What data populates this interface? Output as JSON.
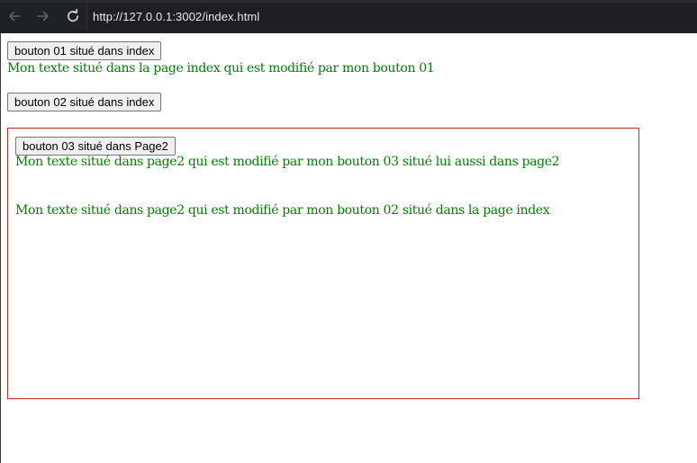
{
  "browser": {
    "back_icon": "arrow-left-icon",
    "forward_icon": "arrow-right-icon",
    "reload_icon": "reload-icon",
    "url": "http://127.0.0.1:3002/index.html",
    "colors": {
      "toolbar_bg": "#202124",
      "icon_color": "#9aa0a6",
      "text_color": "#e8eaed"
    }
  },
  "index": {
    "button_01_label": "bouton 01 situé dans index",
    "text_01": "Mon texte situé dans la page index qui est modifié par mon bouton 01",
    "button_02_label": "bouton 02 situé dans index"
  },
  "page2": {
    "button_03_label": "bouton 03 situé dans Page2",
    "text_03": "Mon texte situé dans page2 qui est modifié par mon bouton 03 situé lui aussi dans page2",
    "text_02": "Mon texte situé dans page2 qui est modifié par mon bouton 02 situé dans la page index",
    "border_color": "#c62828"
  },
  "colors": {
    "text_green": "#008000",
    "button_bg": "#efefef"
  }
}
